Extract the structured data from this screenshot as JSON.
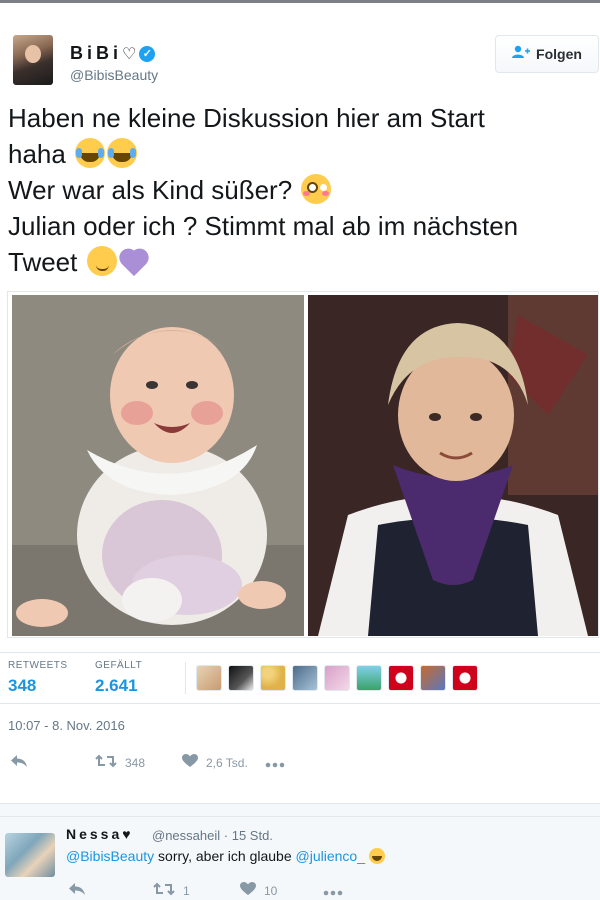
{
  "profile": {
    "display_name": "BiBi",
    "name_heart": "♡",
    "verified_icon": "verified-badge-icon",
    "handle": "@BibisBeauty"
  },
  "follow_button": {
    "label": "Folgen",
    "icon": "add-user-icon"
  },
  "tweet": {
    "lines": [
      "Haben ne kleine Diskussion hier am Start",
      "haha",
      "Wer war als Kind süßer?",
      "Julian oder ich ? Stimmt mal ab im nächsten",
      "Tweet"
    ],
    "emojis": [
      "face-with-tears-of-joy",
      "flushed-face",
      "smirking-face",
      "purple-heart"
    ]
  },
  "media": {
    "images": [
      "baby-photo-left",
      "toddler-photo-right"
    ]
  },
  "stats": {
    "retweets_label": "RETWEETS",
    "retweets_value": "348",
    "likes_label": "GEFÄLLT",
    "likes_value": "2.641",
    "liker_avatar_count": 9
  },
  "timestamp": "10:07 - 8. Nov. 2016",
  "actions": {
    "reply_icon": "reply-icon",
    "retweet_icon": "retweet-icon",
    "retweet_count": "348",
    "like_icon": "heart-icon",
    "like_count": "2,6 Tsd.",
    "more_icon": "more-icon"
  },
  "reply": {
    "name": "Nessa",
    "name_heart": "♥",
    "handle": "@nessaheil",
    "separator": "·",
    "time": "15 Std.",
    "mention_1": "@BibisBeauty",
    "text": " sorry, aber ich glaube ",
    "mention_2": "@julienco_",
    "retweet_count": "1",
    "like_count": "10"
  },
  "colors": {
    "accent": "#1b95e0",
    "verified": "#1da1f2",
    "muted": "#657786",
    "divider": "#e1e8ed"
  }
}
